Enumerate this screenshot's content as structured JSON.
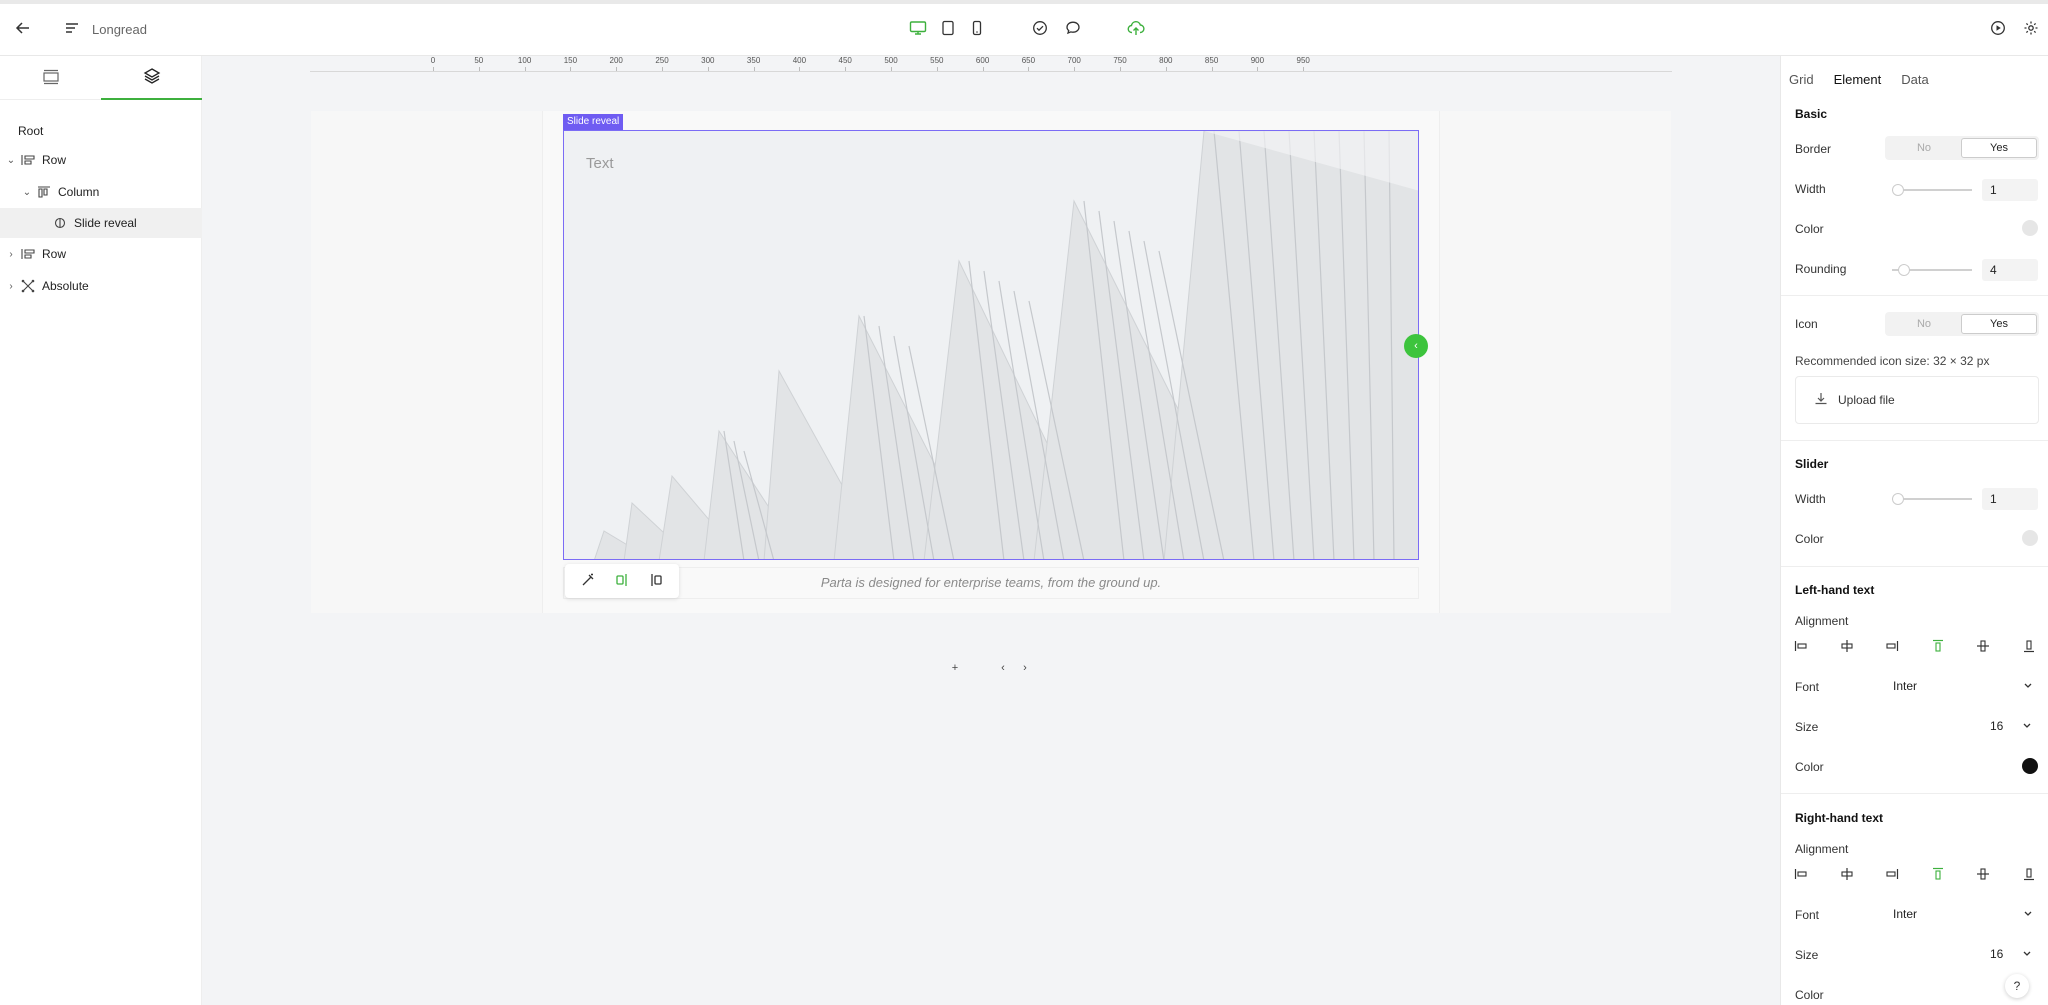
{
  "app": {
    "doc_title": "Longread"
  },
  "colors": {
    "accent": "#3db03d",
    "selection": "#6f5cf2",
    "handle": "#3dc43d"
  },
  "topbar": {
    "left_icons": [
      "back-arrow-icon",
      "menu-lines-icon"
    ],
    "center_icons": [
      "desktop-icon",
      "tablet-icon",
      "phone-icon",
      "check-circle-icon",
      "comment-icon",
      "publish-icon"
    ],
    "right_icons": [
      "play-icon",
      "settings-icon"
    ]
  },
  "layers": {
    "tabs": [
      "sections-icon",
      "layers-icon"
    ],
    "root": "Root",
    "items": [
      {
        "label": "Row",
        "icon": "row-icon",
        "expanded": true
      },
      {
        "label": "Column",
        "icon": "column-icon",
        "expanded": true
      },
      {
        "label": "Slide reveal",
        "icon": "slide-reveal-icon",
        "selected": true
      },
      {
        "label": "Row",
        "icon": "row-icon",
        "expanded": false
      },
      {
        "label": "Absolute",
        "icon": "absolute-icon",
        "expanded": false
      }
    ]
  },
  "canvas": {
    "ruler": [
      "0",
      "50",
      "100",
      "150",
      "200",
      "250",
      "300",
      "350",
      "400",
      "450",
      "500",
      "550",
      "600",
      "650",
      "700",
      "750",
      "800",
      "850",
      "900",
      "950"
    ],
    "block_label": "Slide reveal",
    "slide_text": "Text",
    "caption": "Parta is designed for enterprise teams, from the ground up."
  },
  "panel": {
    "tabs": [
      "Grid",
      "Element",
      "Data"
    ],
    "active_tab": "Element",
    "basic": {
      "heading": "Basic",
      "border_label": "Border",
      "no": "No",
      "yes": "Yes",
      "border_value": "Yes",
      "width_label": "Width",
      "width_value": "1",
      "color_label": "Color",
      "color_value": "#e6e6e6",
      "rounding_label": "Rounding",
      "rounding_value": "4",
      "icon_label": "Icon",
      "icon_value": "Yes",
      "icon_hint": "Recommended icon size: 32 × 32 px",
      "upload_label": "Upload file"
    },
    "slider": {
      "heading": "Slider",
      "width_label": "Width",
      "width_value": "1",
      "color_label": "Color",
      "color_value": "#e6e6e6"
    },
    "left_text": {
      "heading": "Left-hand text",
      "alignment_label": "Alignment",
      "font_label": "Font",
      "font_value": "Inter",
      "size_label": "Size",
      "size_value": "16",
      "color_label": "Color",
      "color_value": "#111111"
    },
    "right_text": {
      "heading": "Right-hand text",
      "alignment_label": "Alignment",
      "font_label": "Font",
      "font_value": "Inter",
      "size_label": "Size",
      "size_value": "16",
      "color_label": "Color"
    }
  },
  "help": "?"
}
